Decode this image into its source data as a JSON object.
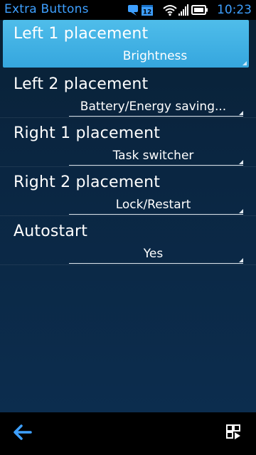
{
  "statusbar": {
    "app_title": "Extra Buttons",
    "calendar_day": "12",
    "clock": "10:23",
    "icons": [
      "chat-bubble-icon",
      "calendar-icon",
      "wifi-icon",
      "signal-bars-icon",
      "battery-icon"
    ]
  },
  "settings": [
    {
      "label": "Left 1 placement",
      "value": "Brightness",
      "selected": true
    },
    {
      "label": "Left 2 placement",
      "value": "Battery/Energy saving...",
      "selected": false
    },
    {
      "label": "Right 1 placement",
      "value": "Task switcher",
      "selected": false
    },
    {
      "label": "Right 2 placement",
      "value": "Lock/Restart",
      "selected": false
    },
    {
      "label": "Autostart",
      "value": "Yes",
      "selected": false
    }
  ],
  "toolbar": {
    "back_icon": "back-arrow-icon",
    "menu_icon": "options-menu-icon"
  },
  "colors": {
    "accent": "#3ea0ff",
    "selected_bg": "#40b2e6",
    "content_bg": "#0a2540"
  }
}
